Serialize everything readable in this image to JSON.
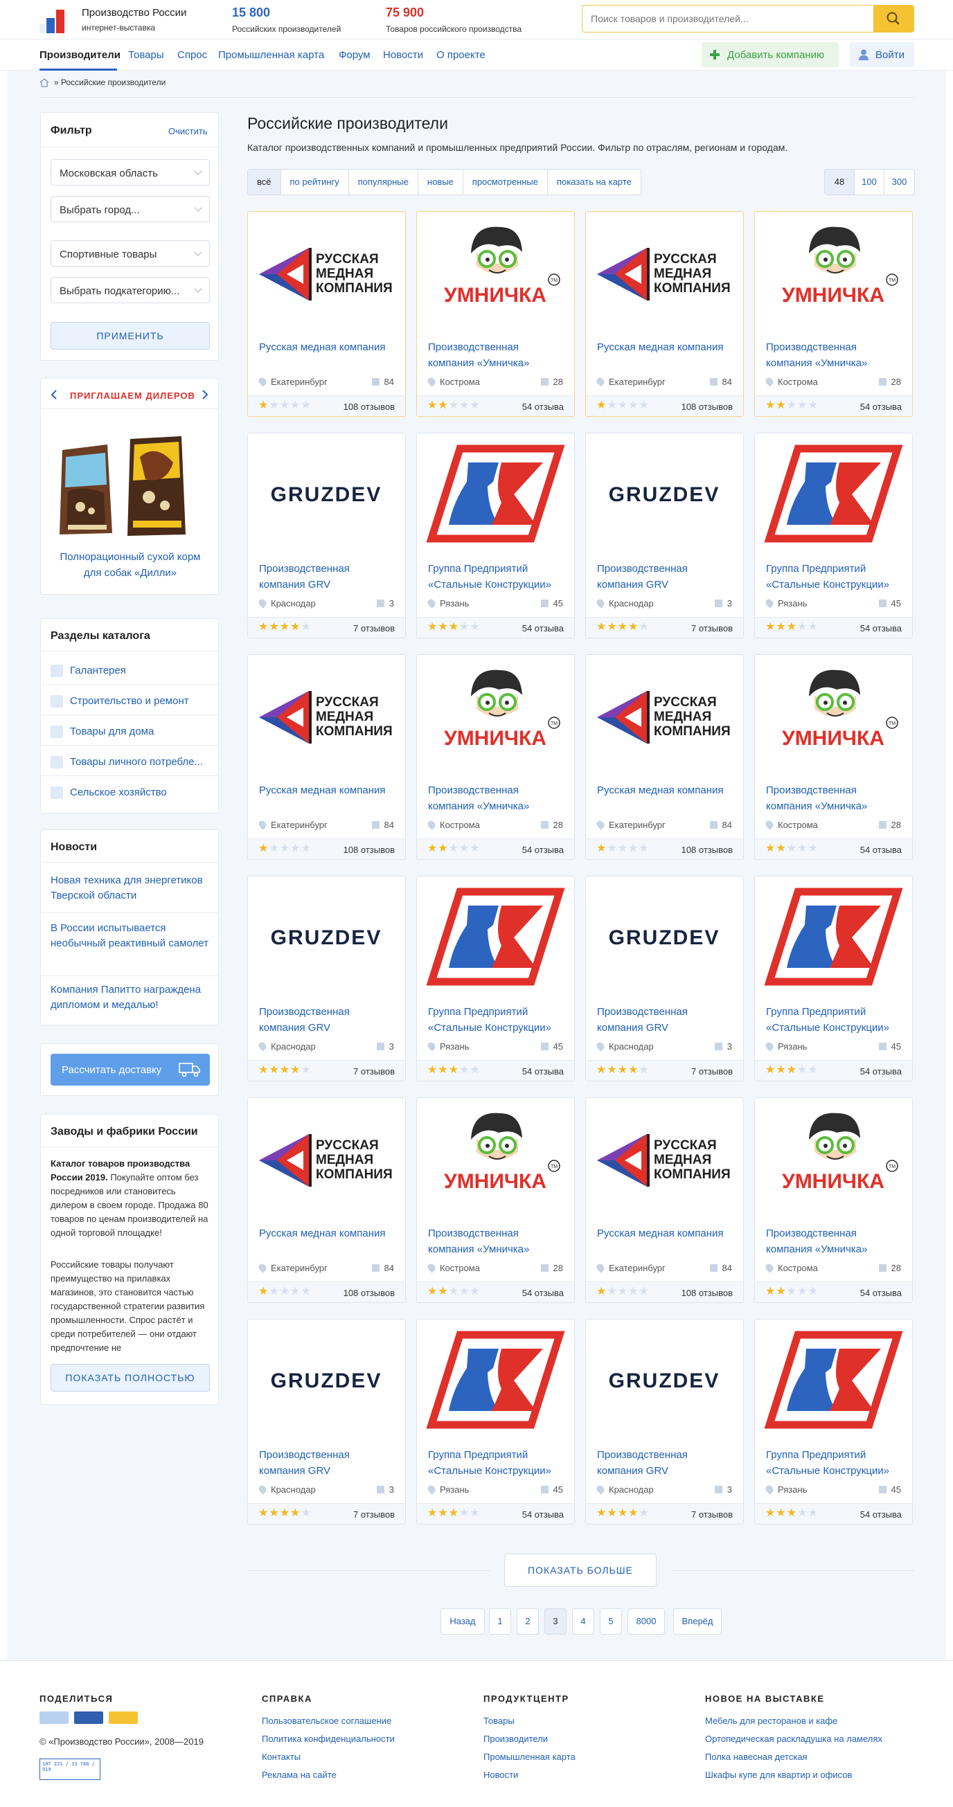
{
  "header": {
    "site_name": "Производство России",
    "site_sub": "интернет-выставка",
    "stat1_num": "15 800",
    "stat1_label": "Российских производителей",
    "stat2_num": "75 900",
    "stat2_label": "Товаров российского производства",
    "search_placeholder": "Поиск товаров и производителей..."
  },
  "nav": {
    "items": [
      "Производители",
      "Товары",
      "Спрос",
      "Промышленная карта",
      "Форум",
      "Новости",
      "О проекте"
    ],
    "add_company": "Добавить компанию",
    "login": "Войти"
  },
  "breadcrumb": "» Российские производители",
  "filter": {
    "title": "Фильтр",
    "clear": "Очистить",
    "region": "Московская область",
    "city": "Выбрать город...",
    "category": "Спортивные товары",
    "subcategory": "Выбрать подкатегорию...",
    "apply": "ПРИМЕНИТЬ"
  },
  "dealers": {
    "title": "ПРИГЛАШАЕМ ДИЛЕРОВ",
    "product": "Полнорационный сухой корм для собак «Дилли»"
  },
  "catalog": {
    "title": "Разделы каталога",
    "items": [
      "Галантерея",
      "Строительство и ремонт",
      "Товары для дома",
      "Товары личного потребле...",
      "Сельское хозяйство"
    ]
  },
  "news": {
    "title": "Новости",
    "items": [
      "Новая техника для энергетиков Тверской области",
      "В России испытывается необычный реактивный самолет",
      "Компания Папитто награждена дипломом и медалью!"
    ]
  },
  "delivery_btn": "Рассчитать доставку",
  "promo": {
    "title": "Заводы и фабрики России",
    "p1_bold": "Каталог товаров производства России 2019.",
    "p1": " Покупайте оптом без посредников или становитесь дилером в своем городе. Продажа 80 товаров по ценам производителей на одной торговой площадке!",
    "p2": "Российские товары получают преимущество на прилавках магазинов, это становится частью государственной стратегии развития промышленности. Спрос растёт и среди потребителей — они отдают предпочтение не",
    "show_full": "ПОКАЗАТЬ ПОЛНОСТЬЮ"
  },
  "content": {
    "title": "Российские производители",
    "desc": "Каталог производственных компаний и промышленных предприятий России. Фильтр по отраслям, регионам и городам.",
    "tabs": [
      "всё",
      "по рейтингу",
      "популярные",
      "новые",
      "просмотренные",
      "показать на карте"
    ],
    "per_page": [
      "48",
      "100",
      "300"
    ]
  },
  "companies": [
    {
      "logo": "rmk",
      "name": "Русская медная компания",
      "city": "Екатеринбург",
      "count": "84",
      "stars": 1,
      "reviews": "108 отзывов"
    },
    {
      "logo": "umnichka",
      "name": "Производственная компания «Умничка»",
      "city": "Кострома",
      "count": "28",
      "stars": 2,
      "reviews": "54 отзыва"
    },
    {
      "logo": "gruzdev",
      "name": "Производственная компания GRV",
      "city": "Краснодар",
      "count": "3",
      "stars": 4,
      "reviews": "7 отзывов"
    },
    {
      "logo": "sk",
      "name": "Группа Предприятий «Стальные Конструкции»",
      "city": "Рязань",
      "count": "45",
      "stars": 3,
      "reviews": "54 отзыва"
    }
  ],
  "logo_text": {
    "rmk": [
      "РУССКАЯ",
      "МЕДНАЯ",
      "КОМПАНИЯ"
    ],
    "umnichka": "УМНИЧКА",
    "umnichka_tm": "TM",
    "gruzdev": "GRUZDEV"
  },
  "show_more": "ПОКАЗАТЬ БОЛЬШЕ",
  "pagination": [
    "Назад",
    "1",
    "2",
    "3",
    "4",
    "5",
    "8000",
    "Вперёд"
  ],
  "footer": {
    "share_title": "ПОДЕЛИТЬСЯ",
    "copyright": "© «Производство России», 2008—2019",
    "counter": "107 221 / 33 788 / 919",
    "help_title": "СПРАВКА",
    "help": [
      "Пользовательское соглашение",
      "Политика конфиденциальности",
      "Контакты",
      "Реклама на сайте"
    ],
    "pc_title": "ПРОДУКТЦЕНТР",
    "pc": [
      "Товары",
      "Производители",
      "Промышленная карта",
      "Новости"
    ],
    "new_title": "НОВОЕ НА ВЫСТАВКЕ",
    "new": [
      "Мебель для ресторанов и кафе",
      "Ортопедическая раскладушка на ламелях",
      "Полка навесная детская",
      "Шкафы купе для квартир и офисов"
    ]
  },
  "colors": {
    "accent": "#2160b5",
    "yellow": "#f5c332",
    "red": "#e0302a",
    "green": "#35a33f",
    "star": "#f3b81f"
  }
}
